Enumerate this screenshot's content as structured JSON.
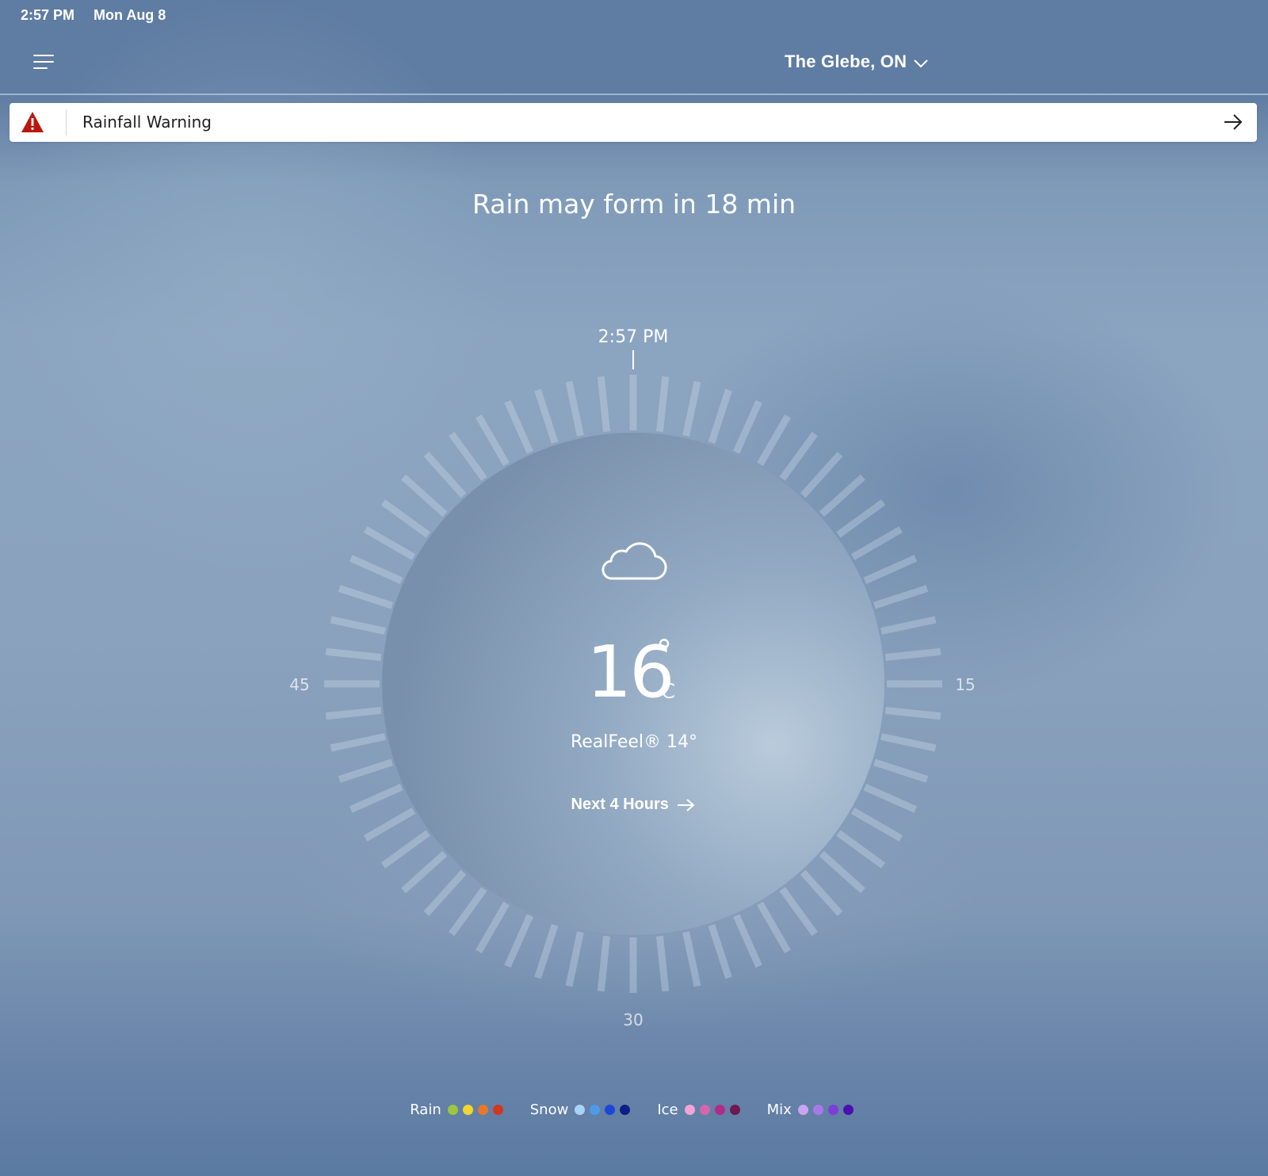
{
  "status_bar": {
    "time": "2:57 PM",
    "date": "Mon Aug 8"
  },
  "header": {
    "location": "The Glebe, ON",
    "menu_icon": "hamburger-menu-icon",
    "dropdown_icon": "chevron-down-icon"
  },
  "alert": {
    "text": "Rainfall Warning",
    "icon": "warning-triangle-icon",
    "action_icon": "arrow-right-icon",
    "icon_color": "#b7190f"
  },
  "headline": "Rain may form in 18 min",
  "dial": {
    "current_time": "2:57 PM",
    "minute_labels": {
      "right": "15",
      "bottom": "30",
      "left": "45"
    },
    "tick_count": 60
  },
  "current": {
    "condition_icon": "cloud-icon",
    "temperature": "16",
    "degree_symbol": "°",
    "unit": "C",
    "realfeel": "RealFeel® 14°",
    "next_link": "Next 4 Hours"
  },
  "legend": [
    {
      "label": "Rain",
      "colors": [
        "#9ec641",
        "#f2d530",
        "#e8772a",
        "#d2371f"
      ]
    },
    {
      "label": "Snow",
      "colors": [
        "#a9d3f7",
        "#4f9ae8",
        "#1a47d6",
        "#0d1f85"
      ]
    },
    {
      "label": "Ice",
      "colors": [
        "#efa6d4",
        "#d366ad",
        "#b02b87",
        "#6e1850"
      ]
    },
    {
      "label": "Mix",
      "colors": [
        "#c9a4ef",
        "#a779e6",
        "#7b3fd8",
        "#4a10b0"
      ]
    }
  ]
}
